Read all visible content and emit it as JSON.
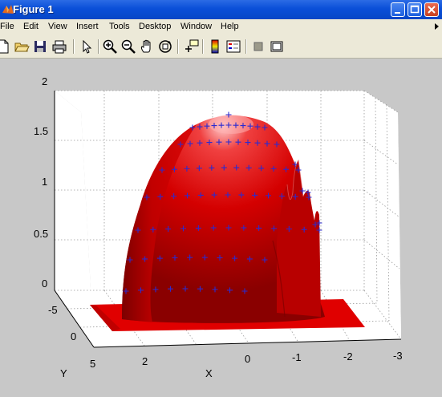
{
  "window": {
    "title": "Figure 1"
  },
  "menu": [
    "File",
    "Edit",
    "View",
    "Insert",
    "Tools",
    "Desktop",
    "Window",
    "Help"
  ],
  "toolbar": [
    "new-file",
    "open-file",
    "save",
    "print",
    "pointer",
    "zoom-in",
    "zoom-out",
    "pan",
    "rotate-3d",
    "data-cursor",
    "colorbar",
    "legend",
    "hide-plot-tools",
    "show-plot-tools"
  ],
  "plot": {
    "z_ticks": [
      "0",
      "0.5",
      "1",
      "1.5",
      "2"
    ],
    "x_ticks": [
      "2",
      "0",
      "-1",
      "-2",
      "-3"
    ],
    "y_ticks": [
      "-5",
      "0",
      "5"
    ],
    "xlabel": "X",
    "ylabel": "Y",
    "surface_color": "#cc0000",
    "marker_color": "#2b2bd0"
  },
  "chart_data": {
    "type": "surface",
    "zlim": [
      0,
      2
    ],
    "x_ticks": [
      2,
      0,
      -1,
      -2,
      -3
    ],
    "y_ticks": [
      -5,
      0,
      5
    ],
    "z_ticks": [
      0,
      0.5,
      1,
      1.5,
      2
    ],
    "xlabel": "X",
    "ylabel": "Y",
    "grid": true
  }
}
